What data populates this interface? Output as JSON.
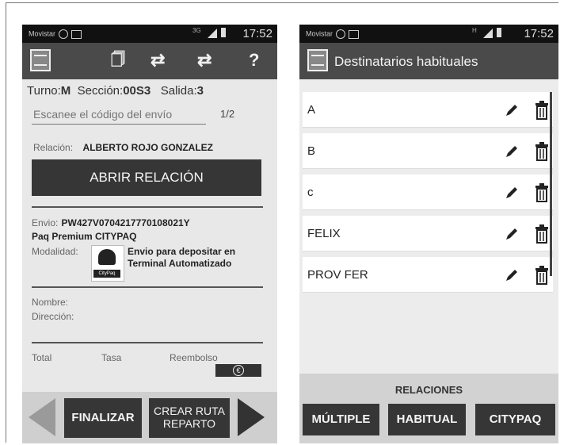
{
  "left": {
    "status": {
      "carrier": "Movistar",
      "network": "3G",
      "time": "17:52"
    },
    "toolbar": {
      "icons": [
        "app-icon",
        "copy-icon",
        "sync-icon",
        "sync-alt-icon",
        "help-icon"
      ],
      "help_label": "?"
    },
    "turno_label": "Turno:",
    "turno_value": "M",
    "seccion_label": "Sección:",
    "seccion_value": "00S3",
    "salida_label": "Salida:",
    "salida_value": "3",
    "scan_placeholder": "Escanee el código del envío",
    "counter": "1/2",
    "relacion_label": "Relación:",
    "relacion_value": "ALBERTO ROJO GONZALEZ",
    "abrir_button": "ABRIR RELACIÓN",
    "envio_label": "Envio:",
    "envio_value": "PW427V0704217770108021Y",
    "paq_label": "Paq Premium CITYPAQ",
    "modalidad_label": "Modalidad:",
    "modalidad_value_1": "Envio para depositar en",
    "modalidad_value_2": "Terminal Automatizado",
    "citypaq_logo": "CityPaq",
    "nombre_label": "Nombre:",
    "direccion_label": "Dirección:",
    "total_label": "Total",
    "tasa_label": "Tasa",
    "reembolso_label": "Reembolso",
    "euro_symbol": "€",
    "finalizar_button": "FINALIZAR",
    "crear_ruta_1": "CREAR RUTA",
    "crear_ruta_2": "REPARTO"
  },
  "right": {
    "status": {
      "carrier": "Movistar",
      "network": "H",
      "time": "17:52"
    },
    "title": "Destinatarios habituales",
    "items": [
      {
        "name": "A"
      },
      {
        "name": "B"
      },
      {
        "name": "c"
      },
      {
        "name": "FELIX"
      },
      {
        "name": "PROV FER"
      }
    ],
    "relaciones_title": "RELACIONES",
    "btn_multiple": "MÚLTIPLE",
    "btn_habitual": "HABITUAL",
    "btn_citypaq": "CITYPAQ"
  }
}
